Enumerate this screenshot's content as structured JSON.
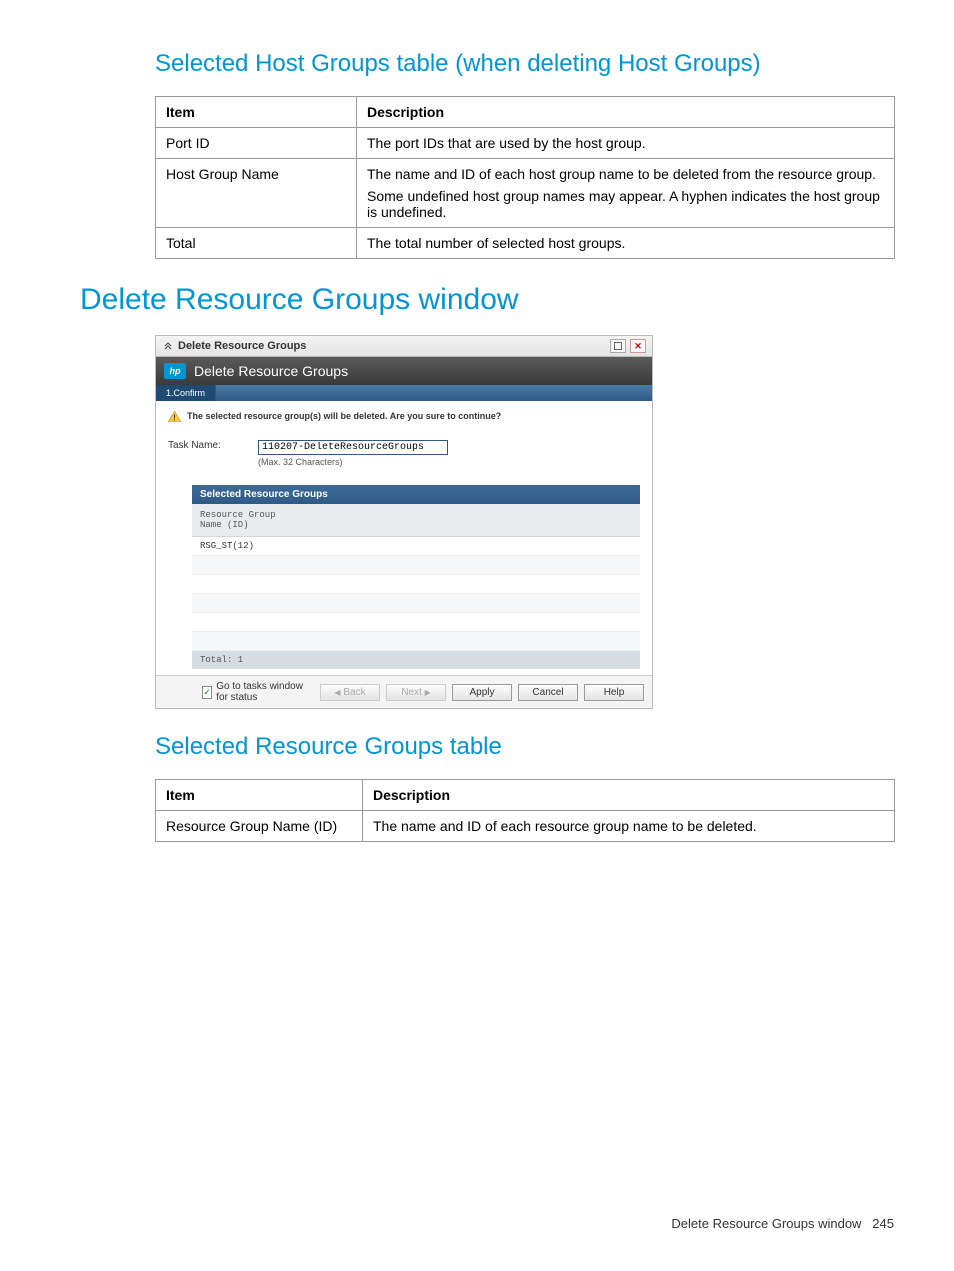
{
  "section1": {
    "heading": "Selected Host Groups table (when deleting Host Groups)",
    "columns": [
      "Item",
      "Description"
    ],
    "rows": [
      {
        "item": "Port ID",
        "desc": "The port IDs that are used by the host group."
      },
      {
        "item": "Host Group Name",
        "desc1": "The name and ID of each host group name to be deleted from the resource group.",
        "desc2": "Some undefined host group names may appear. A hyphen indicates the host group is undefined."
      },
      {
        "item": "Total",
        "desc": "The total number of selected host groups."
      }
    ]
  },
  "section2": {
    "heading": "Delete Resource Groups window"
  },
  "window": {
    "title": "Delete Resource Groups",
    "banner": "Delete Resource Groups",
    "step": "1.Confirm",
    "warning": "The selected resource group(s) will be deleted. Are you sure to continue?",
    "task_label": "Task Name:",
    "task_value": "110207-DeleteResourceGroups",
    "task_hint": "(Max. 32 Characters)",
    "inner_header": "Selected Resource Groups",
    "col1": "Resource Group\nName (ID)",
    "row1": "RSG_ST(12)",
    "total": "Total: 1",
    "checkbox_label": "Go to tasks window for status",
    "btn_back": "Back",
    "btn_next": "Next",
    "btn_apply": "Apply",
    "btn_cancel": "Cancel",
    "btn_help": "Help"
  },
  "section3": {
    "heading": "Selected Resource Groups table",
    "columns": [
      "Item",
      "Description"
    ],
    "rows": [
      {
        "item": "Resource Group Name (ID)",
        "desc": "The name and ID of each resource group name to be deleted."
      }
    ]
  },
  "footer": {
    "text": "Delete Resource Groups window",
    "page": "245"
  }
}
